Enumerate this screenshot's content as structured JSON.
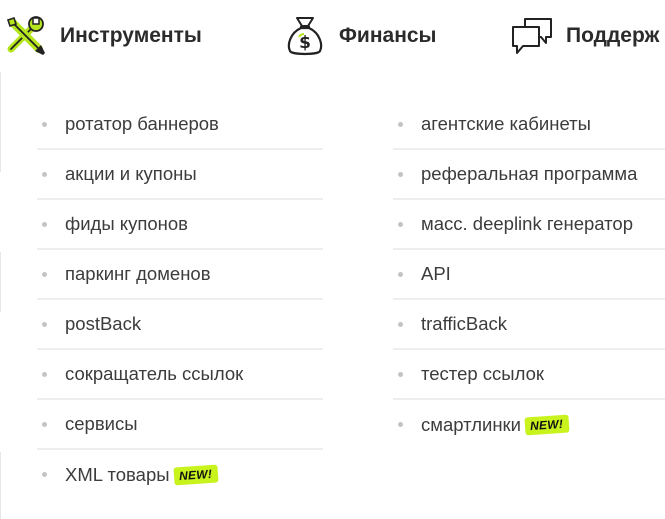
{
  "nav": {
    "tools_label": "Инструменты",
    "finance_label": "Финансы",
    "support_label": "Поддерж"
  },
  "colors": {
    "badge_bg": "#c9f31d",
    "accent_icon": "#b5e61d"
  },
  "menu": {
    "left": [
      {
        "label": "ротатор баннеров"
      },
      {
        "label": "акции и купоны"
      },
      {
        "label": "фиды купонов"
      },
      {
        "label": "паркинг доменов"
      },
      {
        "label": "postBack"
      },
      {
        "label": "сокращатель ссылок"
      },
      {
        "label": "сервисы"
      },
      {
        "label": "XML товары",
        "badge": "NEW!"
      }
    ],
    "right": [
      {
        "label": "агентские кабинеты"
      },
      {
        "label": "реферальная программа"
      },
      {
        "label": "масс. deeplink генератор"
      },
      {
        "label": "API"
      },
      {
        "label": "trafficBack"
      },
      {
        "label": "тестер ссылок"
      },
      {
        "label": "смартлинки",
        "badge": "NEW!"
      }
    ]
  }
}
